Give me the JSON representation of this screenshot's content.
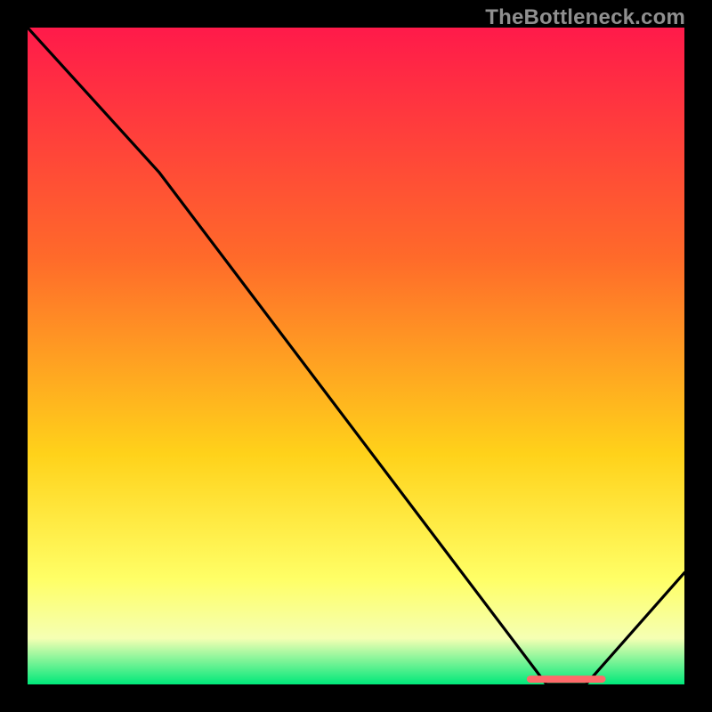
{
  "watermark": "TheBottleneck.com",
  "colors": {
    "bg": "#000000",
    "grad_top": "#ff1a4a",
    "grad_mid1": "#ff6a2a",
    "grad_mid2": "#ffd21a",
    "grad_mid3": "#ffff66",
    "grad_mid4": "#f5ffb3",
    "grad_bottom": "#00e87a",
    "curve": "#000000",
    "marker": "#ff6a6a"
  },
  "chart_data": {
    "type": "line",
    "title": "",
    "xlabel": "",
    "ylabel": "",
    "xlim": [
      0,
      100
    ],
    "ylim": [
      0,
      100
    ],
    "series": [
      {
        "name": "curve",
        "x": [
          0,
          20,
          79,
          85,
          100
        ],
        "y": [
          100,
          78,
          0,
          0,
          17
        ]
      }
    ],
    "marker": {
      "x_start": 76,
      "x_end": 88,
      "y": 0.8
    }
  }
}
